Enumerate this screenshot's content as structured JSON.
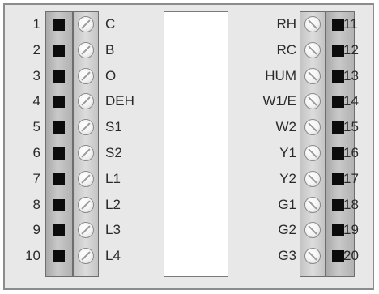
{
  "left_terminals": [
    {
      "number": "1",
      "label": "C"
    },
    {
      "number": "2",
      "label": "B"
    },
    {
      "number": "3",
      "label": "O"
    },
    {
      "number": "4",
      "label": "DEH"
    },
    {
      "number": "5",
      "label": "S1"
    },
    {
      "number": "6",
      "label": "S2"
    },
    {
      "number": "7",
      "label": "L1"
    },
    {
      "number": "8",
      "label": "L2"
    },
    {
      "number": "9",
      "label": "L3"
    },
    {
      "number": "10",
      "label": "L4"
    }
  ],
  "right_terminals": [
    {
      "number": "11",
      "label": "RH"
    },
    {
      "number": "12",
      "label": "RC"
    },
    {
      "number": "13",
      "label": "HUM"
    },
    {
      "number": "14",
      "label": "W1/E"
    },
    {
      "number": "15",
      "label": "W2"
    },
    {
      "number": "16",
      "label": "Y1"
    },
    {
      "number": "17",
      "label": "Y2"
    },
    {
      "number": "18",
      "label": "G1"
    },
    {
      "number": "19",
      "label": "G2"
    },
    {
      "number": "20",
      "label": "G3"
    }
  ],
  "colors": {
    "board": "#e8e8e8",
    "strip": "#b9b9b9",
    "terminal_square": "#0c0c0c",
    "screw": "#f2f2f2"
  }
}
